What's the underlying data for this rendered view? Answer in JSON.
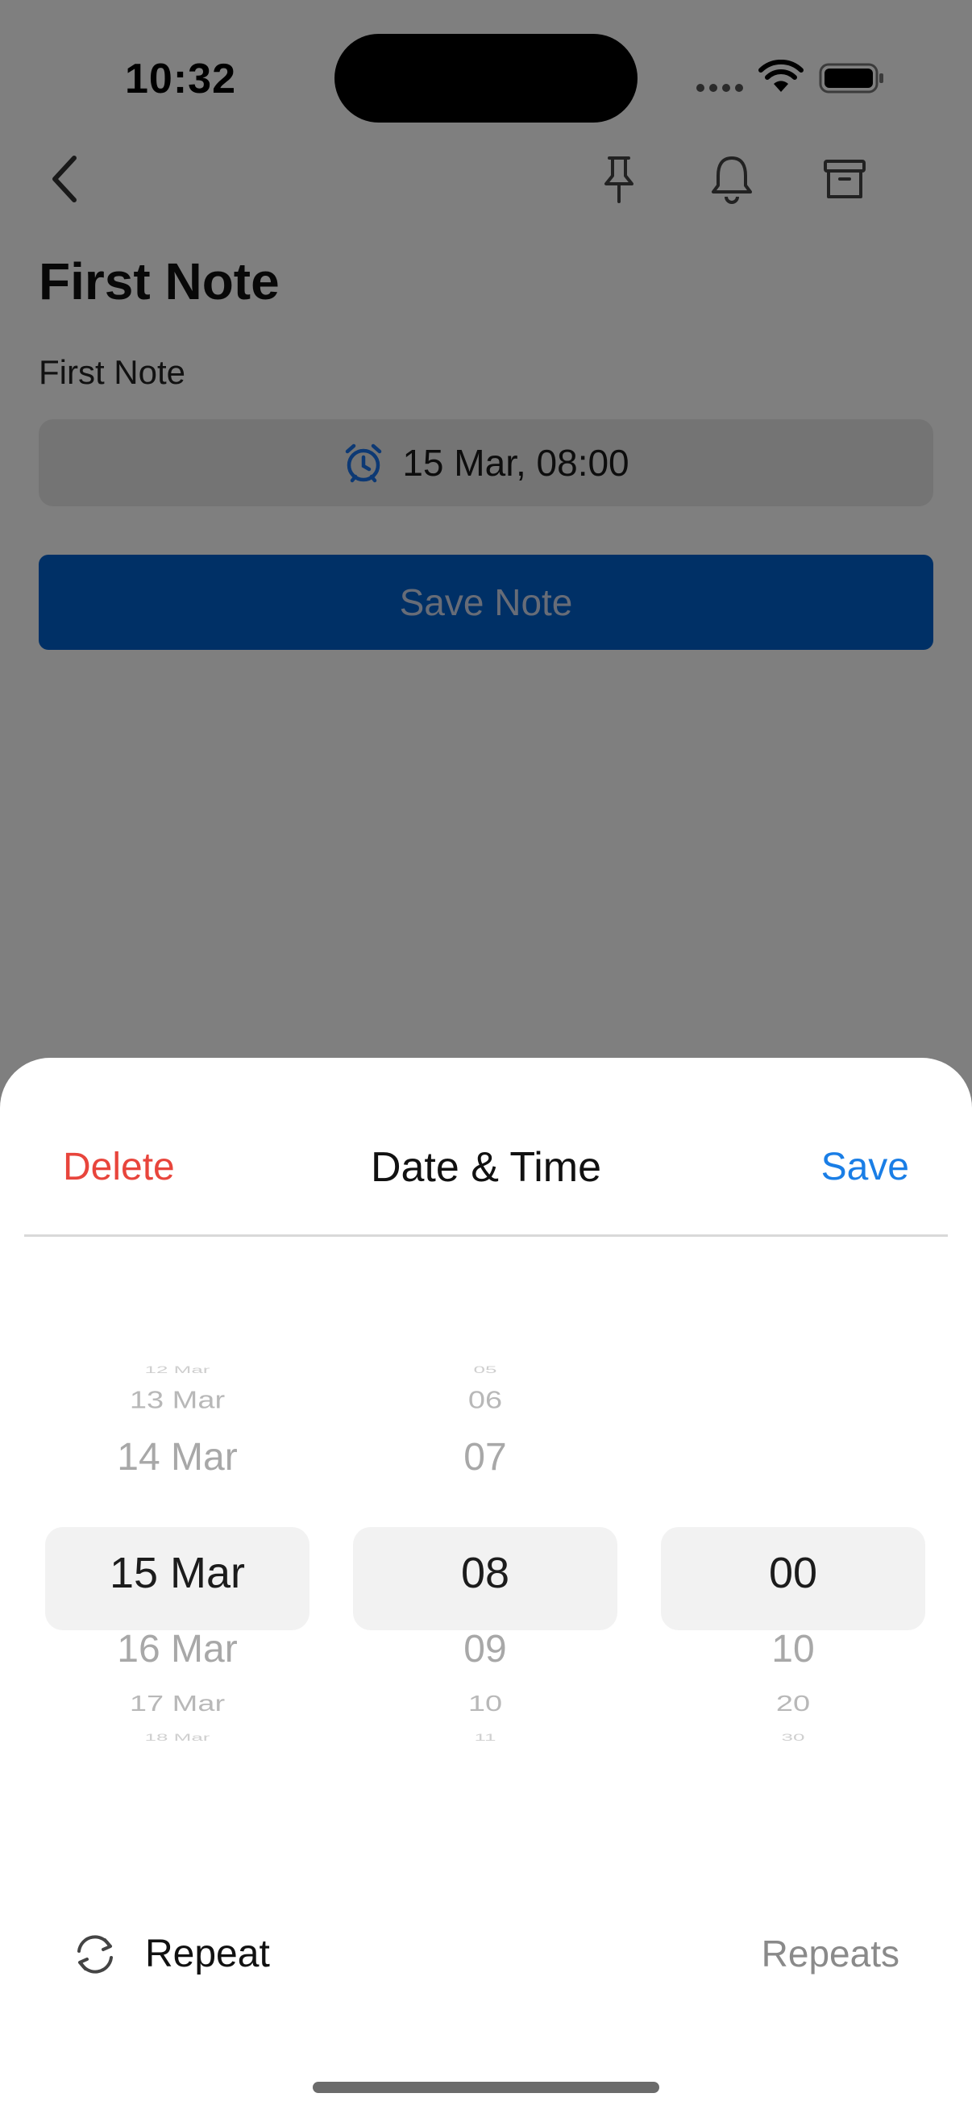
{
  "status_bar": {
    "time": "10:32"
  },
  "nav": {
    "back_icon": "chevron-left-icon",
    "pin_icon": "pin-icon",
    "bell_icon": "bell-icon",
    "archive_icon": "archive-icon"
  },
  "note": {
    "title": "First Note",
    "body": "First Note",
    "reminder_chip": {
      "icon": "alarm-clock-icon",
      "text": "15 Mar, 08:00"
    },
    "save_label": "Save Note"
  },
  "sheet": {
    "delete_label": "Delete",
    "title": "Date & Time",
    "save_label": "Save",
    "pickers": {
      "date": {
        "items": [
          "12 Mar",
          "13 Mar",
          "14 Mar",
          "15 Mar",
          "16 Mar",
          "17 Mar",
          "18 Mar"
        ],
        "selected": "15 Mar"
      },
      "hour": {
        "items": [
          "05",
          "06",
          "07",
          "08",
          "09",
          "10",
          "11"
        ],
        "selected": "08"
      },
      "minute": {
        "items": [
          "",
          "",
          "",
          "00",
          "10",
          "20",
          "30"
        ],
        "selected": "00"
      }
    },
    "repeat": {
      "icon": "repeat-icon",
      "label": "Repeat",
      "value": "Repeats"
    }
  },
  "colors": {
    "accent_blue": "#1a7ee6",
    "delete_red": "#e8453c",
    "save_note_button": "#0060cc",
    "alarm_icon": "#1a73e8"
  }
}
